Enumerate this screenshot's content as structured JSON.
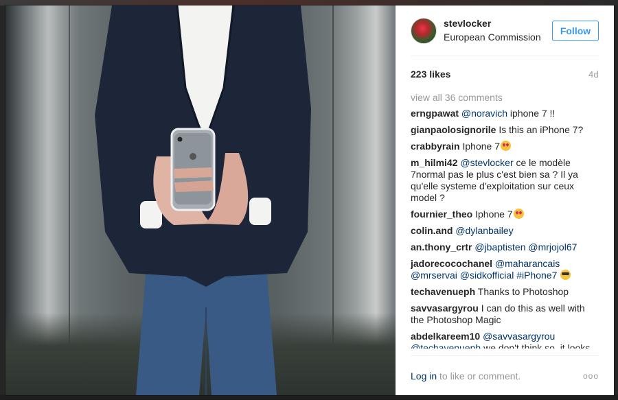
{
  "post": {
    "username": "stevlocker",
    "location": "European Commission",
    "follow_label": "Follow",
    "likes": "223 likes",
    "time_ago": "4d",
    "view_all": "view all 36 comments"
  },
  "comments": [
    {
      "author": "erngpawat",
      "mention": "@noravich",
      "text": " iphone 7 !!"
    },
    {
      "author": "gianpaolosignorile",
      "mention": "",
      "text": " Is this an iPhone 7?"
    },
    {
      "author": "crabbyrain",
      "mention": "",
      "text": " Iphone 7",
      "emoji": "heart-eyes"
    },
    {
      "author": "m_hilmi42",
      "mention": "@stevlocker",
      "text": " ce le modèle 7normal pas le plus c'est bien sa ? Il ya qu'elle systeme d'exploitation sur ceux model ?"
    },
    {
      "author": "fournier_theo",
      "mention": "",
      "text": " Iphone 7",
      "emoji": "heart-eyes"
    },
    {
      "author": "colin.and",
      "mention": "@dylanbailey",
      "text": ""
    },
    {
      "author": "an.thony_crtr",
      "mention": "@jbaptisten @mrjojol67",
      "text": ""
    },
    {
      "author": "jadorecocochanel",
      "mention": "@maharancais @mrservai @sidkofficial #iPhone7",
      "text": " ",
      "emoji": "cool"
    },
    {
      "author": "techavenueph",
      "mention": "",
      "text": " Thanks to Photoshop"
    },
    {
      "author": "savvasargyrou",
      "mention": "",
      "text": " I can do this as well with the Photoshop Magic"
    },
    {
      "author": "abdelkareem10",
      "mention": "@savvasargyrou @techavenueph",
      "text": " we don't think so. it looks"
    }
  ],
  "footer": {
    "login_link": "Log in",
    "login_rest": " to like or comment.",
    "more_icon": "ooo"
  },
  "colors": {
    "link": "#003569",
    "follow_blue": "#3897f0",
    "muted": "#999999"
  },
  "icons": [
    "avatar",
    "more-options-icon",
    "heart-eyes-emoji",
    "cool-emoji"
  ]
}
